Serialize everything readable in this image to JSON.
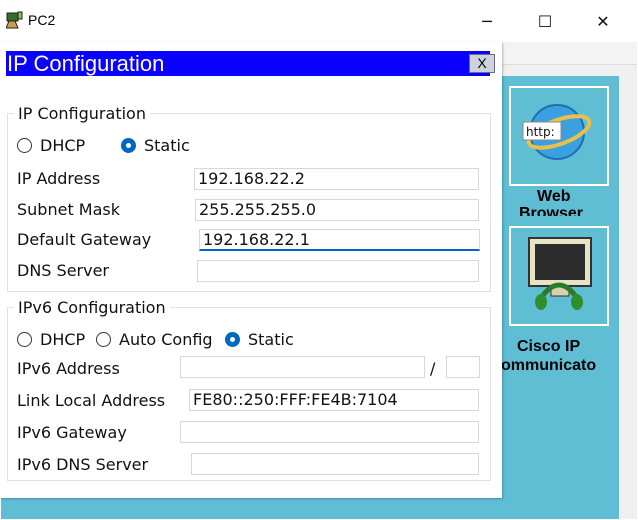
{
  "window": {
    "title": "PC2",
    "minimize_glyph": "─",
    "maximize_glyph": "☐",
    "close_glyph": "✕"
  },
  "desktop": {
    "apps": [
      {
        "name": "web-browser",
        "label_line1": "Web",
        "label_line2": "Browser",
        "icon_text": "http:"
      },
      {
        "name": "cisco-ip-communicator",
        "label_line1": "Cisco IP",
        "label_line2": "ommunicato"
      }
    ]
  },
  "ipconfig": {
    "header_title": "IP Configuration",
    "close_label": "X",
    "ipv4": {
      "legend": "IP Configuration",
      "dhcp_label": "DHCP",
      "static_label": "Static",
      "mode": "static",
      "ip_address_label": "IP Address",
      "ip_address": "192.168.22.2",
      "subnet_mask_label": "Subnet Mask",
      "subnet_mask": "255.255.255.0",
      "default_gateway_label": "Default Gateway",
      "default_gateway": "192.168.22.1",
      "dns_server_label": "DNS Server",
      "dns_server": ""
    },
    "ipv6": {
      "legend": "IPv6 Configuration",
      "dhcp_label": "DHCP",
      "auto_config_label": "Auto Config",
      "static_label": "Static",
      "mode": "static",
      "ipv6_address_label": "IPv6 Address",
      "ipv6_address": "",
      "prefix_separator": "/",
      "prefix_length": "",
      "link_local_label": "Link Local Address",
      "link_local_address": "FE80::250:FFF:FE4B:7104",
      "ipv6_gateway_label": "IPv6 Gateway",
      "ipv6_gateway": "",
      "ipv6_dns_label": "IPv6 DNS Server",
      "ipv6_dns": ""
    }
  },
  "colors": {
    "desktop_bg": "#5fbdd4",
    "header_bg": "#0a00ff",
    "accent": "#0067c0"
  }
}
